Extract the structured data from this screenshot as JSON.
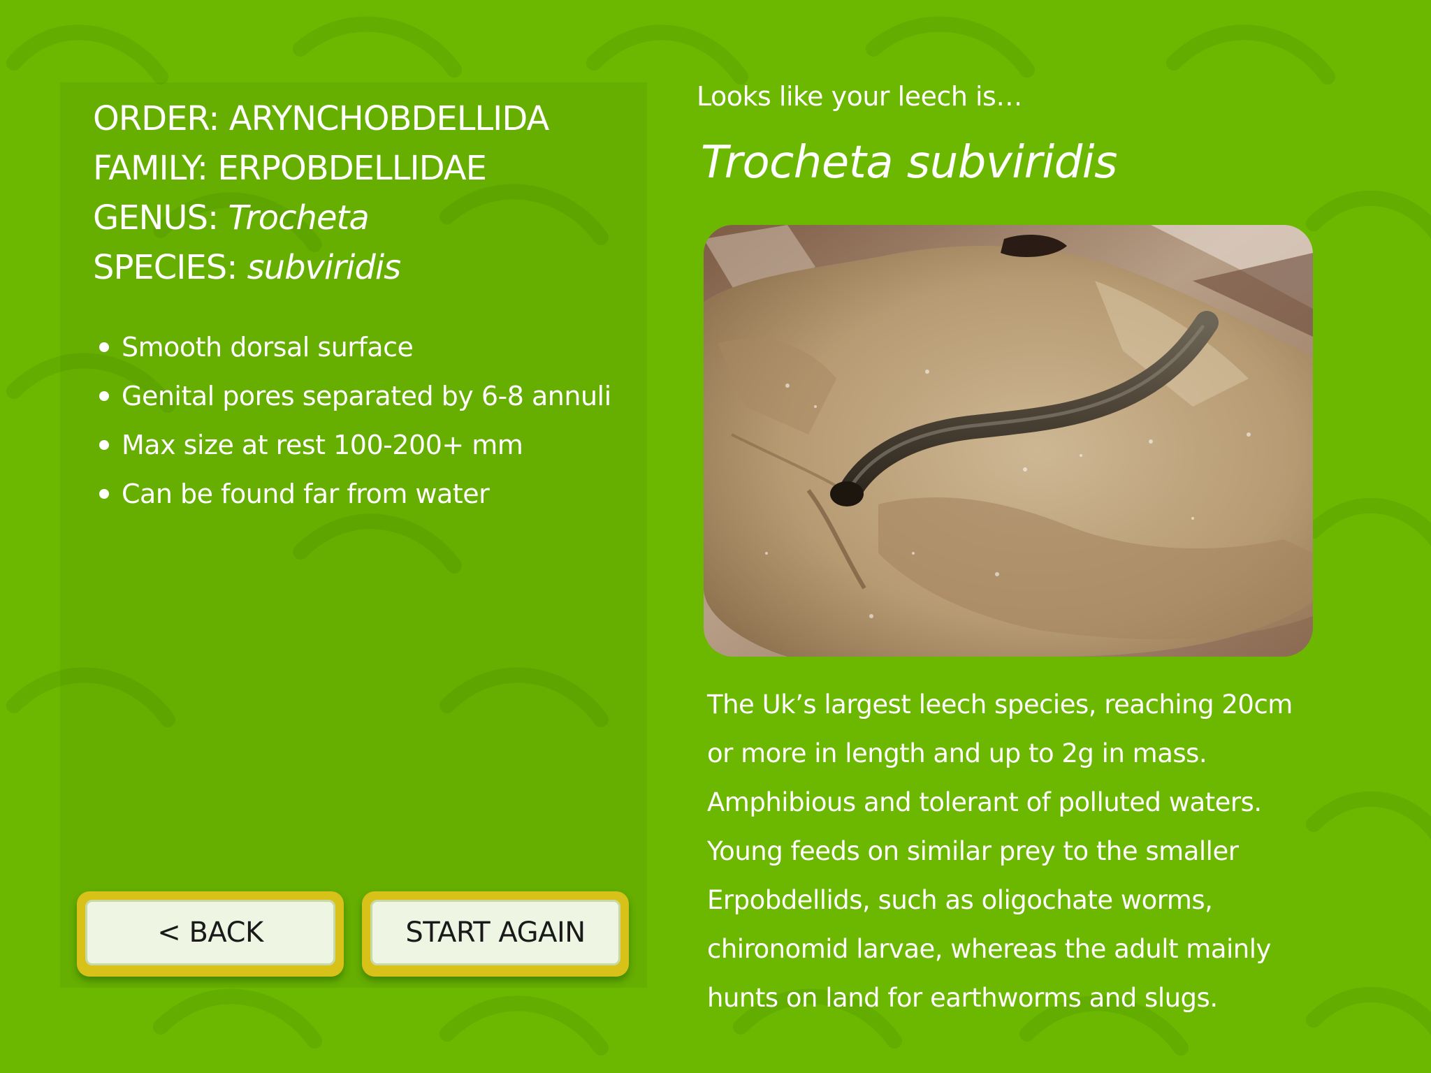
{
  "taxonomy": {
    "order_label": "ORDER:",
    "order_value": "ARYNCHOBDELLIDA",
    "family_label": "FAMILY:",
    "family_value": "ERPOBDELLIDAE",
    "genus_label": "GENUS:",
    "genus_value": "Trocheta",
    "species_label": "SPECIES:",
    "species_value": "subviridis"
  },
  "features": [
    "Smooth dorsal surface",
    "Genital pores separated by 6-8 annuli",
    "Max size at rest 100-200+ mm",
    "Can be found far from water"
  ],
  "buttons": {
    "back_label": "< BACK",
    "start_again_label": "START AGAIN"
  },
  "result": {
    "intro": "Looks like your leech is…",
    "species_name": "Trocheta subviridis",
    "photo_icon": "leech-on-rock-photo",
    "description": "The Uk’s largest leech species, reaching 20cm or more in length and up to 2g in mass. Amphibious and tolerant of polluted waters. Young feeds on similar prey to the smaller Erpobdellids, such as oligochate worms, chironomid larvae, whereas the adult mainly hunts on land for earthworms and slugs."
  },
  "colors": {
    "background": "#6cb800",
    "button_frame": "#d8c21a",
    "button_face": "#eef5e2",
    "text": "#ffffff"
  }
}
